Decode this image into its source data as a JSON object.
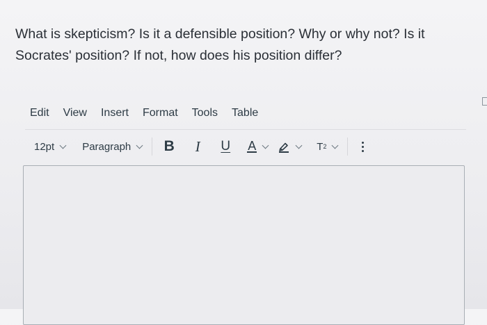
{
  "question": {
    "line1": "What is skepticism? Is it a defensible position? Why or why not? Is it",
    "line2": "Socrates' position? If not, how does his position differ?"
  },
  "menubar": {
    "items": [
      "Edit",
      "View",
      "Insert",
      "Format",
      "Tools",
      "Table"
    ]
  },
  "toolbar": {
    "font_size": "12pt",
    "block_format": "Paragraph",
    "bold": "B",
    "italic": "I",
    "underline": "U",
    "text_color": "A",
    "superscript_base": "T",
    "superscript_exp": "2"
  },
  "editor": {
    "content": ""
  },
  "colors": {
    "text": "#2d3b45",
    "border": "#a8aeb4",
    "background": "#ededf0"
  },
  "icons": [
    "chevron-down-icon",
    "highlighter-icon",
    "more-vertical-icon"
  ]
}
